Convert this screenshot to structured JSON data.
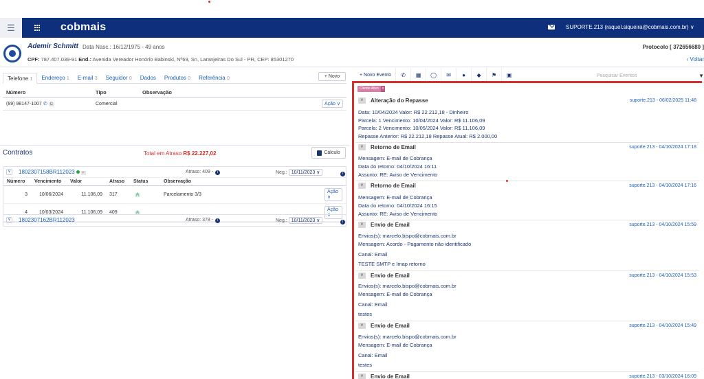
{
  "nav": {
    "menu_icon": "hamburger-icon",
    "apps_icon": "grid-icon",
    "logo": "cobmais",
    "user": "SUPORTE.213 (raquel.siqueira@cobmais.com.br) ∨"
  },
  "client": {
    "name": "Ademir Schmitt",
    "birth": "Data Nasc.: 16/12/1975 - 49 anos",
    "cpf_label": "CPF:",
    "cpf": "787.407.039-91",
    "end_label": "End.:",
    "address": "Avenida Vereador Honório Babinski, Nº69, Sn, Laranjeiras Do Sul - PR, CEP: 85301270",
    "protocolo": "Protocolo [ 372656680 ]",
    "voltar": "‹ Voltar"
  },
  "left": {
    "tabs": [
      {
        "label": "Telefone",
        "count": "1"
      },
      {
        "label": "Endereço",
        "count": "1"
      },
      {
        "label": "E-mail",
        "count": "3"
      },
      {
        "label": "Seguidor",
        "count": "0"
      },
      {
        "label": "Dados",
        "count": ""
      },
      {
        "label": "Produtos",
        "count": "0"
      },
      {
        "label": "Referência",
        "count": "0"
      }
    ],
    "novo": "+ Novo",
    "phone_headers": [
      "Número",
      "Tipo",
      "Observação"
    ],
    "phone": {
      "numero": "(89) 98147-1007",
      "chip": "C",
      "tipo": "Comercial",
      "obs": "",
      "acao": "Ação ∨"
    },
    "contratos_title": "Contratos",
    "atraso_label": "Total em Atraso",
    "atraso_value": "R$ 22.227,02",
    "calculo": "Cálculo",
    "contracts": [
      {
        "number": "1802307158BR112023",
        "flag": "F",
        "atraso": "Atraso: 409 -",
        "neg_label": "Neg.:",
        "neg_date": "10/11/2023 ∨",
        "headers": [
          "Número",
          "Vencimento",
          "Valor",
          "Atraso",
          "Status",
          "Observação"
        ],
        "rows": [
          {
            "numero": "3",
            "venc": "10/06/2024",
            "valor": "11.106,09",
            "atraso": "317",
            "status": "A",
            "obs": "Parcelamento 3/3",
            "acao": "Ação ∨"
          },
          {
            "numero": "4",
            "venc": "10/03/2024",
            "valor": "11.106,09",
            "atraso": "409",
            "status": "A",
            "obs": "",
            "acao": "Ação ∨"
          }
        ]
      },
      {
        "number": "1802307162BR112023",
        "atraso": "Atraso: 378 -",
        "neg_label": "Neg.:",
        "neg_date": "10/11/2023 ∨"
      }
    ]
  },
  "right": {
    "novo_evento": "+ Novo Evento",
    "tool_icons": [
      "phone-icon",
      "calendar-icon",
      "whatsapp-icon",
      "email-icon",
      "location-icon",
      "tag-icon",
      "flag-icon",
      "card-icon"
    ],
    "search_placeholder": "Pesquisar Eventos",
    "badge": "Cliente Ativo",
    "badge_x": "x",
    "events": [
      {
        "title": "Alteração do Repasse",
        "meta": "suporte.213 - 06/02/2025 11:48",
        "lines": [
          "Data: 10/04/2024 Valor: R$ 22.212,18 - Dinheiro",
          "Parcela: 1 Vencimento: 10/04/2024 Valor: R$ 11.106,09",
          "Parcela: 2 Vencimento: 10/05/2024 Valor: R$ 11.106,09",
          "Repasse Anterior: R$ 22.212,18 Repasse Atual: R$ 2.000,00"
        ]
      },
      {
        "title": "Retorno de Email",
        "meta": "suporte.213 - 04/10/2024 17:18",
        "lines": [
          "Mensagem: E-mail de Cobrança",
          "Data do retorno: 04/10/2024 16:11",
          "Assunto: RE: Aviso de Vencimento"
        ]
      },
      {
        "title": "Retorno de Email",
        "meta": "suporte.213 - 04/10/2024 17:16",
        "lines": [
          "Mensagem: E-mail de Cobrança",
          "Data do retorno: 04/10/2024 16:15",
          "Assunto: RE: Aviso de Vencimento"
        ]
      },
      {
        "title": "Envio de Email",
        "meta": "suporte.213 - 04/10/2024 15:59",
        "lines": [
          "Envios(s): marcelo.bispo@cobmais.com.br",
          "Mensagem: Acordo - Pagamento não identificado",
          "Canal: Email",
          "TESTE SMTP e Imap retorno"
        ]
      },
      {
        "title": "Envio de Email",
        "meta": "suporte.213 - 04/10/2024 15:53",
        "lines": [
          "Envios(s): marcelo.bispo@cobmais.com.br",
          "Mensagem: E-mail de Cobrança",
          "Canal: Email",
          "testes"
        ]
      },
      {
        "title": "Envio de Email",
        "meta": "suporte.213 - 04/10/2024 15:49",
        "lines": [
          "Envios(s): marcelo.bispo@cobmais.com.br",
          "Mensagem: E-mail de Cobrança",
          "Canal: Email",
          "testes"
        ]
      },
      {
        "title": "Envio de Email",
        "meta": "suporte.213 - 03/10/2024 16:09",
        "lines": []
      }
    ]
  },
  "colors": {
    "nav": "#0d2f7c",
    "accent_red": "#d3302c",
    "link": "#1c5fb8",
    "badge": "#d580a6"
  }
}
